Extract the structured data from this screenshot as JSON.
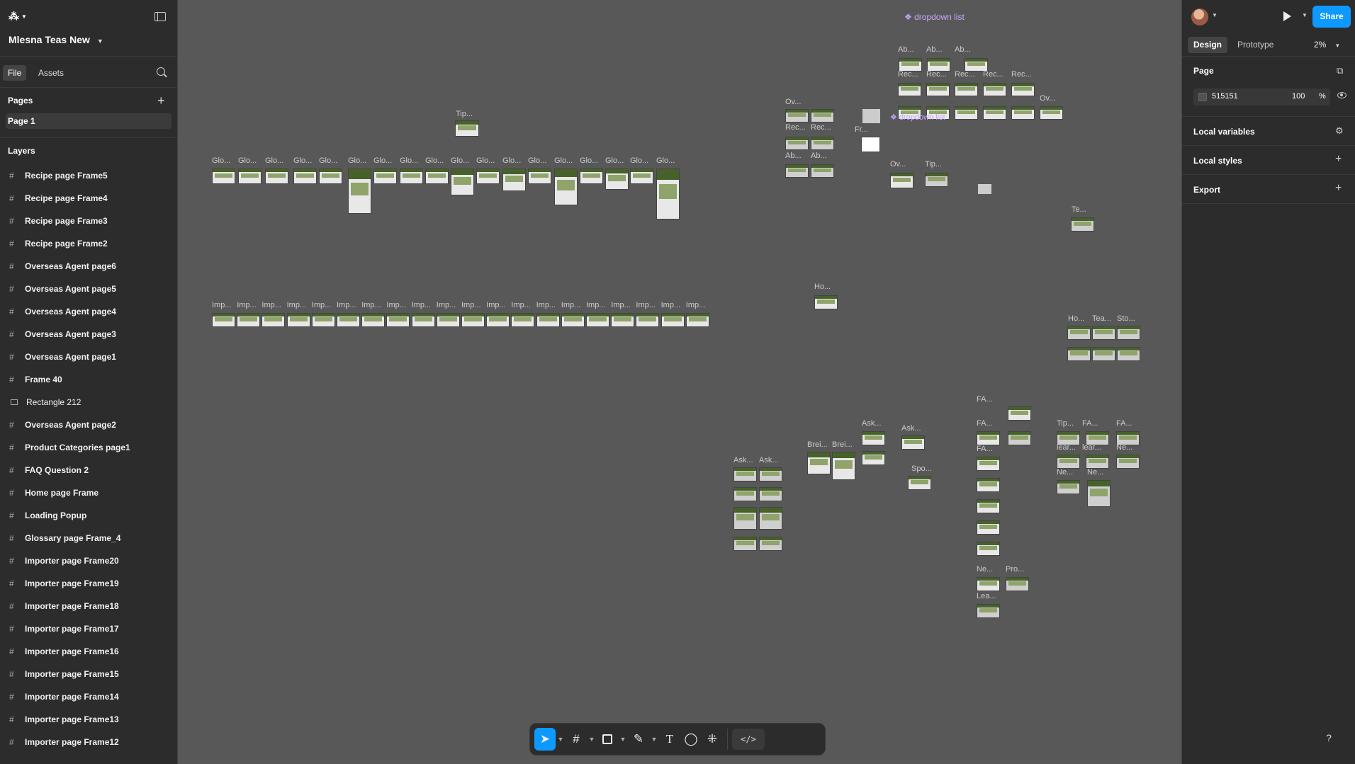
{
  "app": {
    "project_name": "Mlesna Teas New"
  },
  "left_panel": {
    "tabs": [
      "File",
      "Assets"
    ],
    "pages_title": "Pages",
    "pages": [
      "Page 1"
    ],
    "layers_title": "Layers",
    "layers": [
      {
        "name": "Recipe  page Frame5",
        "type": "frame"
      },
      {
        "name": "Recipe  page Frame4",
        "type": "frame"
      },
      {
        "name": "Recipe  page Frame3",
        "type": "frame"
      },
      {
        "name": "Recipe  page Frame2",
        "type": "frame"
      },
      {
        "name": "Overseas Agent page6",
        "type": "frame"
      },
      {
        "name": "Overseas Agent page5",
        "type": "frame"
      },
      {
        "name": "Overseas Agent page4",
        "type": "frame"
      },
      {
        "name": "Overseas Agent page3",
        "type": "frame"
      },
      {
        "name": "Overseas Agent page1",
        "type": "frame"
      },
      {
        "name": "Frame 40",
        "type": "frame"
      },
      {
        "name": "Rectangle 212",
        "type": "rect"
      },
      {
        "name": "Overseas Agent page2",
        "type": "frame"
      },
      {
        "name": "Product Categories page1",
        "type": "frame"
      },
      {
        "name": "FAQ Question 2",
        "type": "frame"
      },
      {
        "name": "Home page Frame",
        "type": "frame"
      },
      {
        "name": "Loading Popup",
        "type": "frame"
      },
      {
        "name": "Glossary page Frame_4",
        "type": "frame"
      },
      {
        "name": "Importer  page Frame20",
        "type": "frame"
      },
      {
        "name": "Importer  page Frame19",
        "type": "frame"
      },
      {
        "name": "Importer  page Frame18",
        "type": "frame"
      },
      {
        "name": "Importer  page Frame17",
        "type": "frame"
      },
      {
        "name": "Importer  page Frame16",
        "type": "frame"
      },
      {
        "name": "Importer  page Frame15",
        "type": "frame"
      },
      {
        "name": "Importer  page Frame14",
        "type": "frame"
      },
      {
        "name": "Importer  page Frame13",
        "type": "frame"
      },
      {
        "name": "Importer  page Frame12",
        "type": "frame"
      }
    ]
  },
  "right_panel": {
    "share_label": "Share",
    "tabs": [
      "Design",
      "Prototype"
    ],
    "zoom": "2%",
    "page_section": "Page",
    "bg_color_hex": "515151",
    "bg_opacity": "100",
    "bg_opacity_unit": "%",
    "sections": [
      "Local variables",
      "Local styles",
      "Export"
    ]
  },
  "canvas": {
    "component_label": "dropdown list",
    "component_label_2": "dropdown list",
    "glo_label": "Glo...",
    "imp_label": "Imp...",
    "tip_label": "Tip...",
    "ov_label": "Ov...",
    "rec_label": "Rec...",
    "ab_label": "Ab...",
    "fr_label": "Fr...",
    "te_label": "Te...",
    "ho_label": "Ho...",
    "tea_label": "Tea...",
    "sto_label": "Sto...",
    "ask_label": "Ask...",
    "brei_label": "Brei...",
    "fa_label": "FA...",
    "ne_label": "Ne...",
    "pro_label": "Pro...",
    "lea_label": "Lea...",
    "spo_label": "Spo...",
    "lear_label": "lear..."
  },
  "colors": {
    "accent": "#0d99ff",
    "canvas_bg": "#585858",
    "panel_bg": "#2c2c2c"
  },
  "help_label": "?"
}
